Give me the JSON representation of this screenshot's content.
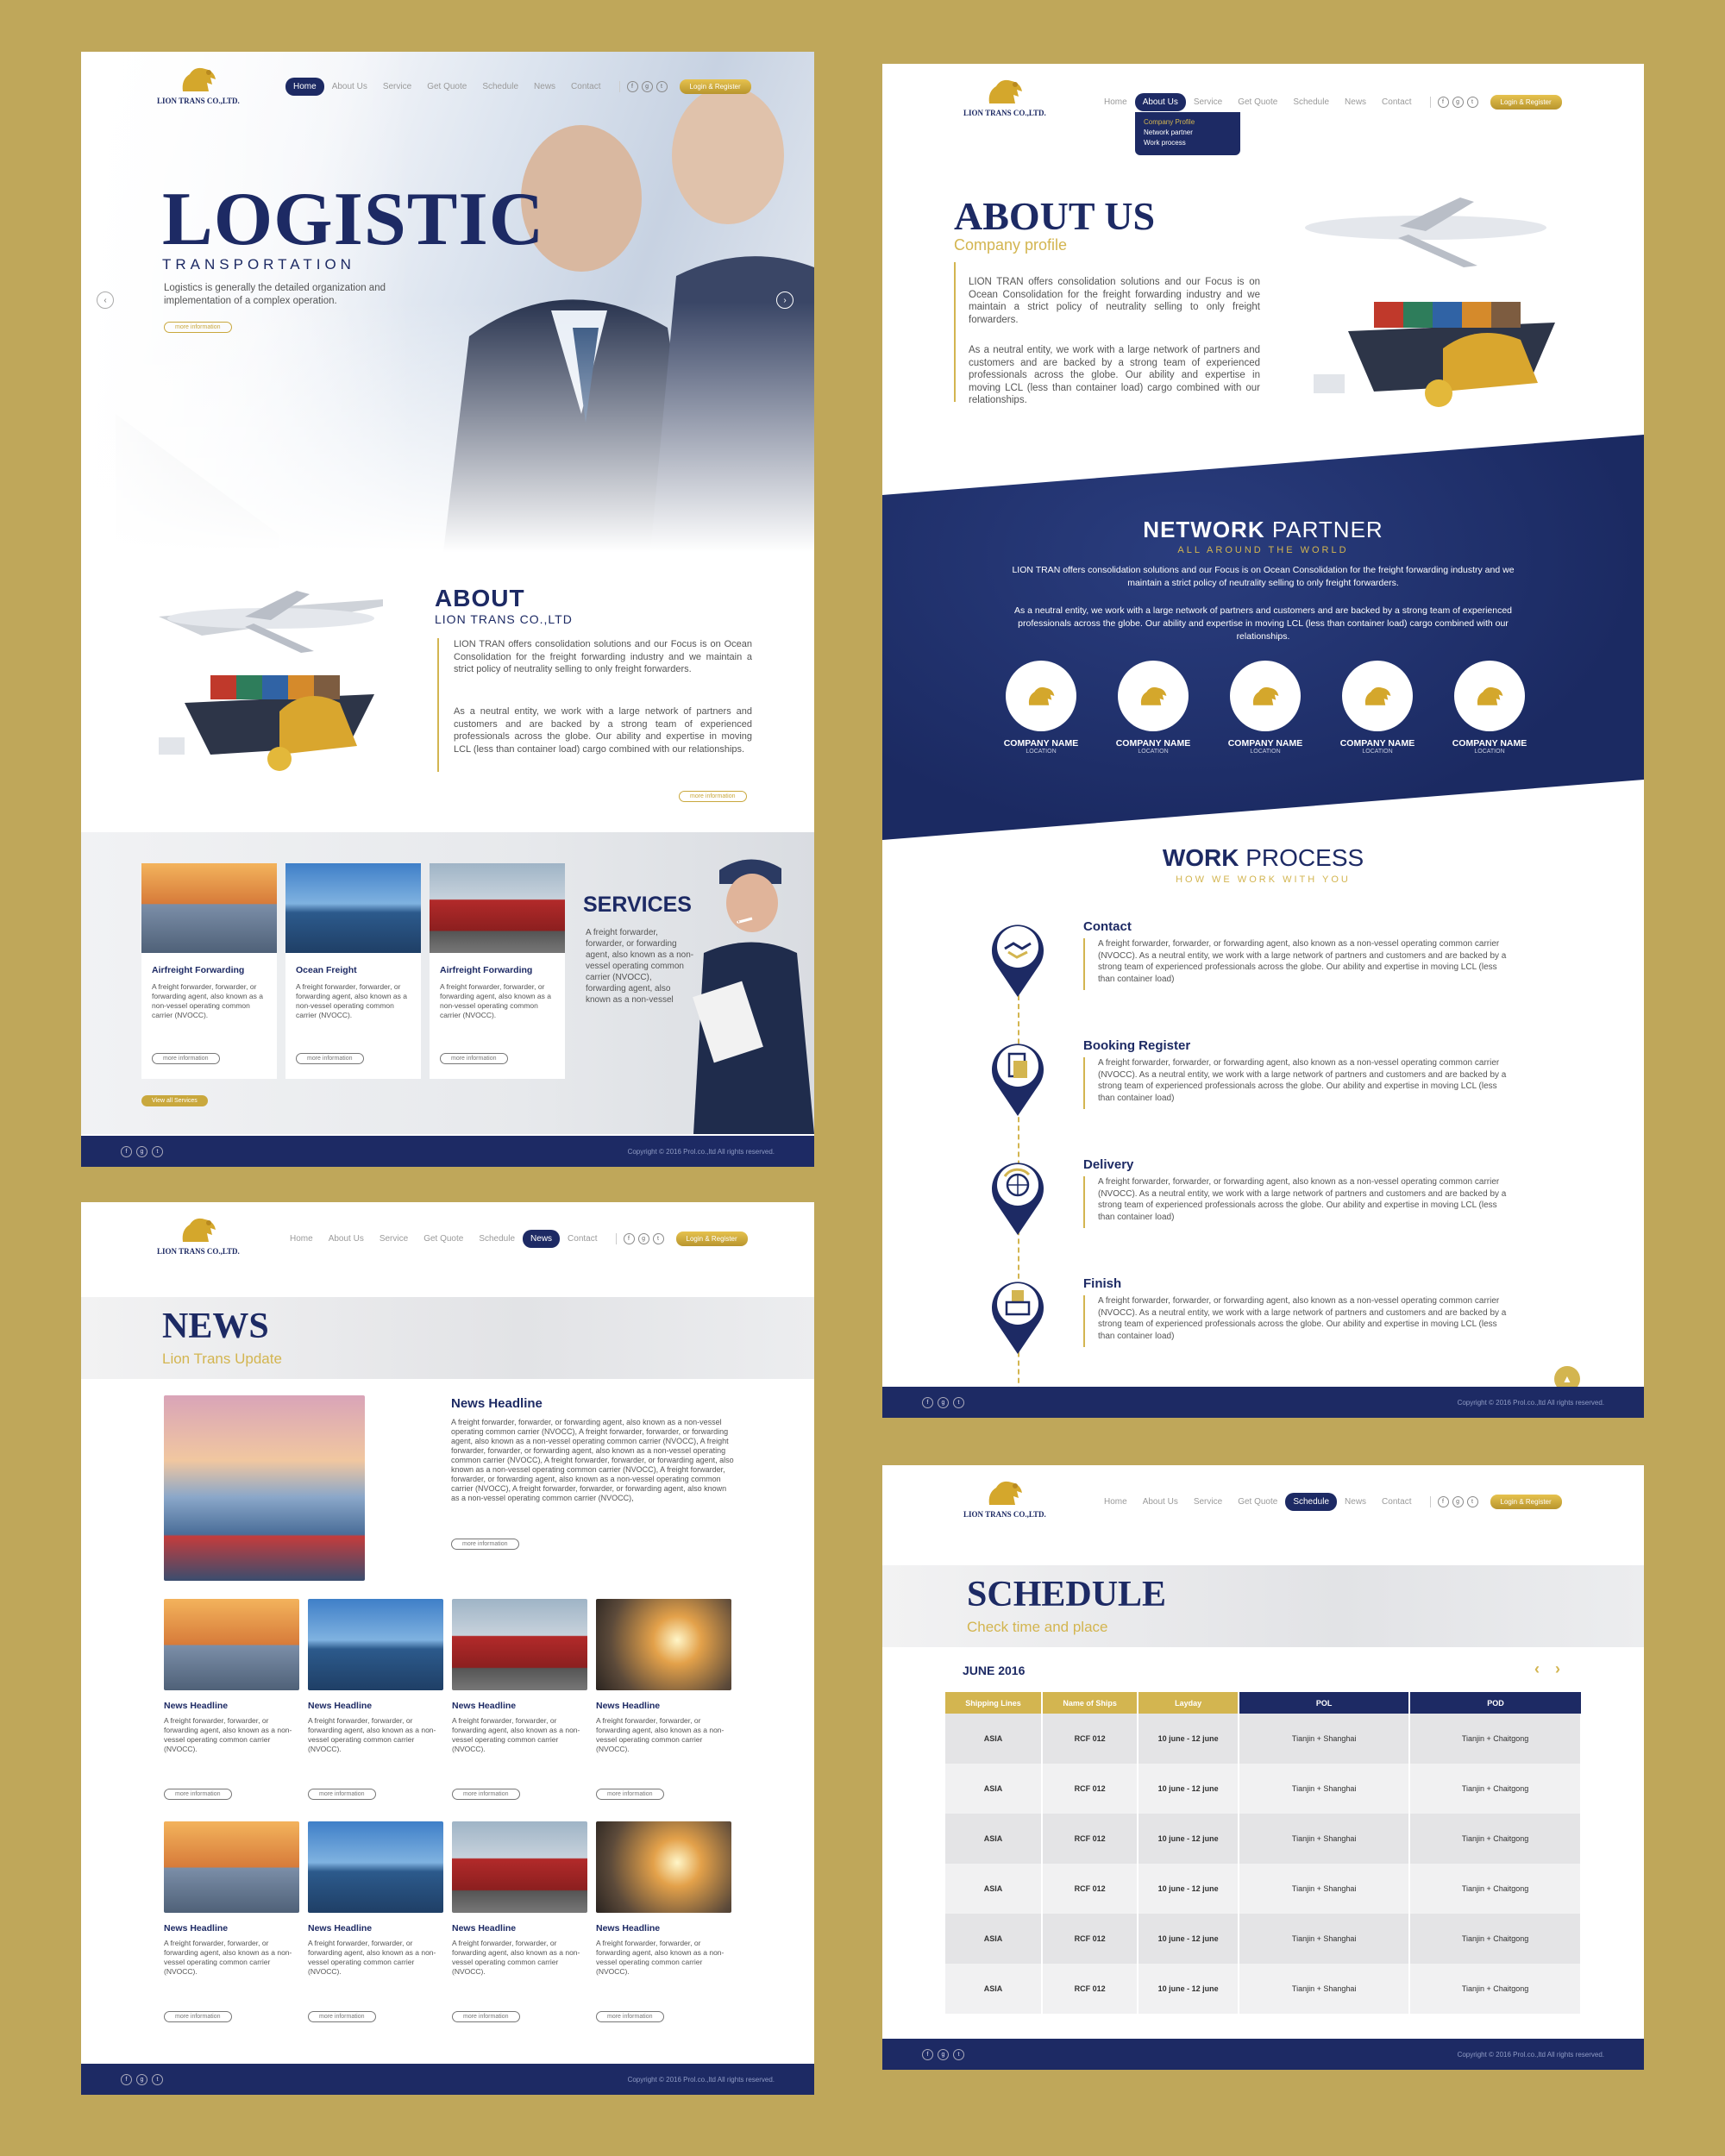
{
  "brand": {
    "logo_text": "LION TRANS CO.,LTD."
  },
  "nav": {
    "items": [
      "Home",
      "About Us",
      "Service",
      "Get Quote",
      "Schedule",
      "News",
      "Contact"
    ],
    "login": "Login & Register"
  },
  "footer": {
    "copyright": "Copyright © 2016 Prol.co.,ltd All rights reserved."
  },
  "home": {
    "hero_title": "LOGISTIC",
    "hero_sub": "TRANSPORTATION",
    "hero_desc": "Logistics is generally the detailed organization and implementation of a complex operation.",
    "more": "more information",
    "about_title": "ABOUT",
    "about_sub": "LION TRANS CO.,LTD",
    "about_p1": "LION TRAN offers consolidation solutions and our Focus is on Ocean Consolidation for the freight forwarding industry and we maintain a strict policy of neutrality selling to only freight forwarders.",
    "about_p2": "As a neutral entity, we work with a large network of partners and customers and are backed by a strong team of experienced professionals across the globe. Our ability and expertise in moving LCL (less than container load) cargo combined with our relationships.",
    "services_title": "SERVICES",
    "services_desc": "A freight forwarder, forwarder, or forwarding agent, also known as a non-vessel operating common carrier (NVOCC), forwarding agent, also known as a non-vessel",
    "view_all": "View all Services",
    "cards": [
      {
        "title": "Airfreight Forwarding",
        "desc": "A freight forwarder, forwarder, or forwarding agent, also known as a non-vessel operating common carrier (NVOCC)."
      },
      {
        "title": "Ocean Freight",
        "desc": "A freight forwarder, forwarder, or forwarding agent, also known as a non-vessel operating common carrier (NVOCC)."
      },
      {
        "title": "Airfreight Forwarding",
        "desc": "A freight forwarder, forwarder, or forwarding agent, also known as a non-vessel operating common carrier (NVOCC)."
      }
    ]
  },
  "aboutpage": {
    "dropdown": [
      "Company Profile",
      "Network partner",
      "Work process"
    ],
    "title": "ABOUT US",
    "subtitle": "Company profile",
    "p1": "LION TRAN offers consolidation solutions and our Focus is on Ocean Consolidation for the freight forwarding industry and we maintain a strict policy of neutrality selling to only freight forwarders.",
    "p2": "As a neutral entity, we work with a large network of partners and customers and are backed by a strong team of experienced professionals across the globe. Our ability and expertise in moving LCL (less than container load) cargo combined with our relationships.",
    "network_title_bold": "NETWORK",
    "network_title_rest": "PARTNER",
    "network_sub": "ALL AROUND THE WORLD",
    "network_p1": "LION TRAN offers consolidation solutions and our Focus is on Ocean Consolidation for the freight forwarding industry and we maintain a strict policy of neutrality selling to only freight forwarders.",
    "network_p2": "As a neutral entity, we work with a large network of partners and customers and are backed by a strong team of experienced professionals across the globe. Our ability and expertise in moving LCL (less than container load) cargo combined with our relationships.",
    "partners": [
      {
        "name": "COMPANY NAME",
        "loc": "LOCATION"
      },
      {
        "name": "COMPANY NAME",
        "loc": "LOCATION"
      },
      {
        "name": "COMPANY NAME",
        "loc": "LOCATION"
      },
      {
        "name": "COMPANY NAME",
        "loc": "LOCATION"
      },
      {
        "name": "COMPANY NAME",
        "loc": "LOCATION"
      }
    ],
    "work_title_bold": "WORK",
    "work_title_rest": "PROCESS",
    "work_sub": "HOW WE WORK WITH YOU",
    "steps": [
      {
        "title": "Contact",
        "icon": "handshake-icon",
        "desc": "A freight forwarder, forwarder, or forwarding agent, also known as a non-vessel operating common carrier (NVOCC). As a neutral entity, we work with a large network of partners and customers and are backed by a strong team of experienced professionals across the globe. Our ability and expertise in moving LCL (less than container load)"
      },
      {
        "title": "Booking Register",
        "icon": "document-icon",
        "desc": "A freight forwarder, forwarder, or forwarding agent, also known as a non-vessel operating common carrier (NVOCC). As a neutral entity, we work with a large network of partners and customers and are backed by a strong team of experienced professionals across the globe. Our ability and expertise in moving LCL (less than container load)"
      },
      {
        "title": "Delivery",
        "icon": "globe-icon",
        "desc": "A freight forwarder, forwarder, or forwarding agent, also known as a non-vessel operating common carrier (NVOCC). As a neutral entity, we work with a large network of partners and customers and are backed by a strong team of experienced professionals across the globe. Our ability and expertise in moving LCL (less than container load)"
      },
      {
        "title": "Finish",
        "icon": "boxes-icon",
        "desc": "A freight forwarder, forwarder, or forwarding agent, also known as a non-vessel operating common carrier (NVOCC). As a neutral entity, we work with a large network of partners and customers and are backed by a strong team of experienced professionals across the globe. Our ability and expertise in moving LCL (less than container load)"
      }
    ]
  },
  "newspage": {
    "title": "NEWS",
    "subtitle": "Lion Trans Update",
    "headline": "News Headline",
    "headline_desc": "A freight forwarder, forwarder, or forwarding agent, also known as a non-vessel operating common carrier (NVOCC), A freight forwarder, forwarder, or forwarding agent, also known as a non-vessel operating common carrier (NVOCC), A freight forwarder, forwarder, or forwarding agent, also known as a non-vessel operating common carrier (NVOCC), A freight forwarder, forwarder, or forwarding agent, also known as a non-vessel operating common carrier (NVOCC), A freight forwarder, forwarder, or forwarding agent, also known as a non-vessel operating common carrier (NVOCC), A freight forwarder, forwarder, or forwarding agent, also known as a non-vessel operating common carrier (NVOCC),",
    "item_title": "News Headline",
    "item_desc": "A freight forwarder, forwarder, or forwarding agent, also known as a non-vessel operating common carrier (NVOCC)."
  },
  "schedule": {
    "title": "SCHEDULE",
    "subtitle": "Check time and place",
    "month": "JUNE 2016",
    "headers": [
      "Shipping Lines",
      "Name of Ships",
      "Layday",
      "POL",
      "POD"
    ],
    "rows": [
      [
        "ASIA",
        "RCF 012",
        "10 june - 12 june",
        "Tianjin + Shanghai",
        "Tianjin + Chaitgong"
      ],
      [
        "ASIA",
        "RCF 012",
        "10 june - 12 june",
        "Tianjin + Shanghai",
        "Tianjin + Chaitgong"
      ],
      [
        "ASIA",
        "RCF 012",
        "10 june - 12 june",
        "Tianjin + Shanghai",
        "Tianjin + Chaitgong"
      ],
      [
        "ASIA",
        "RCF 012",
        "10 june - 12 june",
        "Tianjin + Shanghai",
        "Tianjin + Chaitgong"
      ],
      [
        "ASIA",
        "RCF 012",
        "10 june - 12 june",
        "Tianjin + Shanghai",
        "Tianjin + Chaitgong"
      ],
      [
        "ASIA",
        "RCF 012",
        "10 june - 12 june",
        "Tianjin + Shanghai",
        "Tianjin + Chaitgong"
      ]
    ]
  },
  "colors": {
    "navy": "#1d2a64",
    "gold": "#d3b550",
    "background": "#bfa75a"
  }
}
